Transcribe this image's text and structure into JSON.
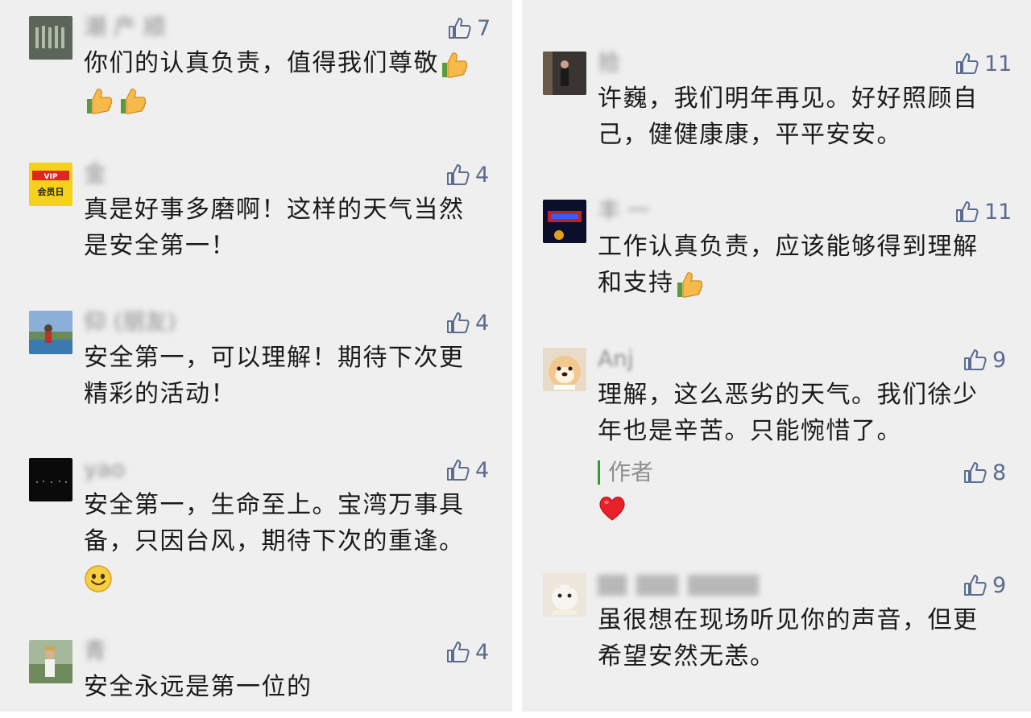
{
  "left_comments": [
    {
      "name": "潮        产        顺",
      "likes": "7",
      "text": "你们的认真负责，值得我们尊敬",
      "emoji": "thumbs-up x3"
    },
    {
      "name": "金      ",
      "likes": "4",
      "text_lines": [
        "真是好事多磨啊！这样的天气当然",
        "是安全第一！"
      ],
      "avatar_text": "会员日"
    },
    {
      "name": "仰        (朋友)",
      "likes": "4",
      "text_lines": [
        "安全第一，可以理解！期待下次更",
        "精彩的活动！"
      ]
    },
    {
      "name": "yao",
      "likes": "4",
      "text_lines": [
        "安全第一，生命至上。宝湾万事具",
        "备，只因台风，期待下次的重逢。"
      ],
      "emoji": "smile"
    },
    {
      "name": "青        ",
      "likes": "4",
      "text": "安全永远是第一位的"
    }
  ],
  "right_comments": [
    {
      "name": "拾      ",
      "likes": "11",
      "text_lines": [
        "许巍，我们明年再见。好好照顾自",
        "己，健健康康，平平安安。"
      ]
    },
    {
      "name": "丰    一",
      "likes": "11",
      "text_lines": [
        "工作认真负责，应该能够得到理解",
        "和支持"
      ],
      "emoji": "thumbs-up"
    },
    {
      "name": "Anj",
      "likes": "9",
      "text_lines": [
        "理解，这么恶劣的天气。我们徐少",
        "年也是辛苦。只能惋惜了。"
      ],
      "author_reply": {
        "label": "作者",
        "likes": "8",
        "emoji": "heart"
      }
    },
    {
      "name": "      ",
      "likes": "9",
      "text_lines": [
        "虽很想在现场听见你的声音，但更",
        "希望安然无恙。"
      ]
    }
  ],
  "colors": {
    "panel_bg": "#efefef",
    "like_color": "#5b6c8f",
    "author_bar": "#2aa22a"
  }
}
